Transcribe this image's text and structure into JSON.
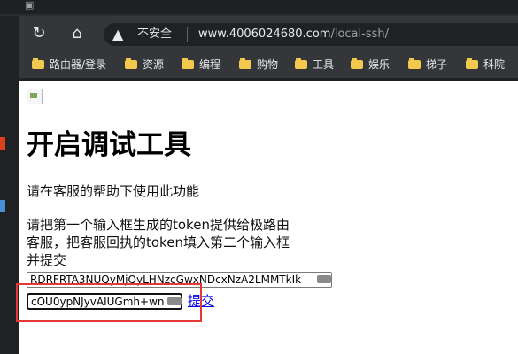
{
  "browser": {
    "security_label": "不安全",
    "url_host": "www.4006024680.com",
    "url_path": "/local-ssh/",
    "bookmarks": [
      "路由器/登录",
      "资源",
      "编程",
      "购物",
      "工具",
      "娱乐",
      "梯子",
      "科院"
    ]
  },
  "page": {
    "heading": "开启调试工具",
    "intro": "请在客服的帮助下使用此功能",
    "instructions": "请把第一个输入框生成的token提供给极路由客服，把客服回执的token填入第二个输入框并提交",
    "token_field_1_value": "RDRFRTA3NUQyMjQyLHNzcGwxNDcxNzA2LMMTkIk",
    "token_field_2_value": "cOU0ypNJyvAIUGmh+wn",
    "submit_label": "提交"
  },
  "icons": {
    "security": "warning-icon",
    "reload": "reload-icon",
    "home": "home-icon",
    "bookmark": "folder-icon",
    "page_image": "broken-image-icon",
    "password_manager": "key-icon"
  },
  "colors": {
    "browser_dark": "#202124",
    "toolbar": "#35363a",
    "folder_yellow": "#f2c94c",
    "link_blue": "#0000ee",
    "highlight_red": "#e53935"
  }
}
